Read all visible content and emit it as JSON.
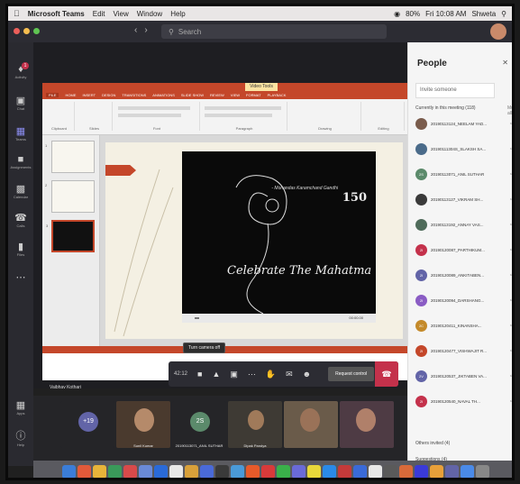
{
  "menubar": {
    "apple": "",
    "app": "Microsoft Teams",
    "items": [
      "Edit",
      "View",
      "Window",
      "Help"
    ],
    "status": {
      "battery": "80%",
      "clock": "Fri 10:08 AM",
      "user": "Shweta"
    }
  },
  "titlebar": {
    "search_placeholder": "Search"
  },
  "rail": {
    "items": [
      {
        "label": "Activity",
        "icon": "bell-icon"
      },
      {
        "label": "Chat",
        "icon": "chat-icon"
      },
      {
        "label": "Teams",
        "icon": "teams-icon"
      },
      {
        "label": "Assignments",
        "icon": "assignments-icon"
      },
      {
        "label": "Calendar",
        "icon": "calendar-icon"
      },
      {
        "label": "Calls",
        "icon": "phone-icon"
      },
      {
        "label": "Files",
        "icon": "file-icon"
      },
      {
        "label": "Apps",
        "icon": "apps-icon"
      },
      {
        "label": "Help",
        "icon": "help-icon"
      }
    ],
    "badge": "1"
  },
  "powerpoint": {
    "tool_label": "Video Tools",
    "tabs": [
      "FILE",
      "HOME",
      "INSERT",
      "DESIGN",
      "TRANSITIONS",
      "ANIMATIONS",
      "SLIDE SHOW",
      "REVIEW",
      "VIEW",
      "FORMAT",
      "PLAYBACK"
    ],
    "groups": [
      "Clipboard",
      "Slides",
      "Font",
      "Paragraph",
      "Drawing",
      "Editing"
    ],
    "thumb_numbers": [
      "1",
      "2",
      "3"
    ],
    "video": {
      "quote": "- Mohandas Karamchand Gandhi",
      "mark": "150",
      "title": "Celebrate The Mahatma",
      "time": "00:00.00"
    }
  },
  "presenter": "Vaibhav Kothari",
  "controls": {
    "tooltip": "Turn camera off",
    "duration": "42:12",
    "request_control": "Request control"
  },
  "participants": [
    {
      "name": "",
      "initials": "+19",
      "color": "#6264a7"
    },
    {
      "name": "Sunil Kumar",
      "initials": "",
      "color": "#4a3a2e"
    },
    {
      "name": "20190113071_ANIL SUTHAR",
      "initials": "2S",
      "color": "#5b8a6b"
    },
    {
      "name": "Dipak Pandya",
      "initials": "",
      "color": "#3e3a34"
    },
    {
      "name": "",
      "initials": "",
      "color": "#6a5b4a"
    },
    {
      "name": "",
      "initials": "",
      "color": "#4e3b44"
    }
  ],
  "people": {
    "title": "People",
    "invite_placeholder": "Invite someone",
    "current_section": "Currently in this meeting (118)",
    "mute_all": "Mute all",
    "list": [
      {
        "name": "20190113124_NEELAM YAD...",
        "initials": "",
        "color": "#7a5c4c"
      },
      {
        "name": "20190111304S_SLAKSH SA...",
        "initials": "",
        "color": "#4a6b8a"
      },
      {
        "name": "20190113071_ANIL SUTHAR",
        "initials": "2S",
        "color": "#5b8a6b"
      },
      {
        "name": "20190113127_VIKRAM SH...",
        "initials": "",
        "color": "#3a3a3a"
      },
      {
        "name": "20190113192_ANNAY VAS...",
        "initials": "",
        "color": "#4f6b5a"
      },
      {
        "name": "20190120087_PARTHIKUM...",
        "initials": "2I",
        "color": "#c4314b"
      },
      {
        "name": "20190120089_ANKITABEN...",
        "initials": "2I",
        "color": "#6264a7"
      },
      {
        "name": "20190120094_DARSHANG...",
        "initials": "2I",
        "color": "#8a5cc4"
      },
      {
        "name": "20190120411_KINANSHA...",
        "initials": "2C",
        "color": "#c48a2a"
      },
      {
        "name": "20190120477_VISHWAJIT R...",
        "initials": "2I",
        "color": "#c4472a"
      },
      {
        "name": "20190120537_JIKTABEN VA...",
        "initials": "2V",
        "color": "#6264a7"
      },
      {
        "name": "20190120540_NAVAL TH...",
        "initials": "2I",
        "color": "#c4314b"
      }
    ],
    "others_invited": "Others invited (4)",
    "suggestions": "Suggestions (4)"
  },
  "dock_colors": [
    "#3b7dd8",
    "#e25a3a",
    "#e8b43a",
    "#3a9a5a",
    "#d84a4a",
    "#6a8ad8",
    "#2a6ad8",
    "#e8e8e8",
    "#d8a03a",
    "#4a6ad8",
    "#3a3a3a",
    "#4a9ad8",
    "#e85a2a",
    "#d83a3a",
    "#3ab04a",
    "#6a6ad8",
    "#e8d83a",
    "#2a8ae8",
    "#c43a3a",
    "#3a6ad8",
    "#e8e8e8",
    "#5a5a5a",
    "#d86a3a",
    "#3a3ad8",
    "#e8a03a",
    "#6264a7",
    "#4a8ae8",
    "#888"
  ]
}
